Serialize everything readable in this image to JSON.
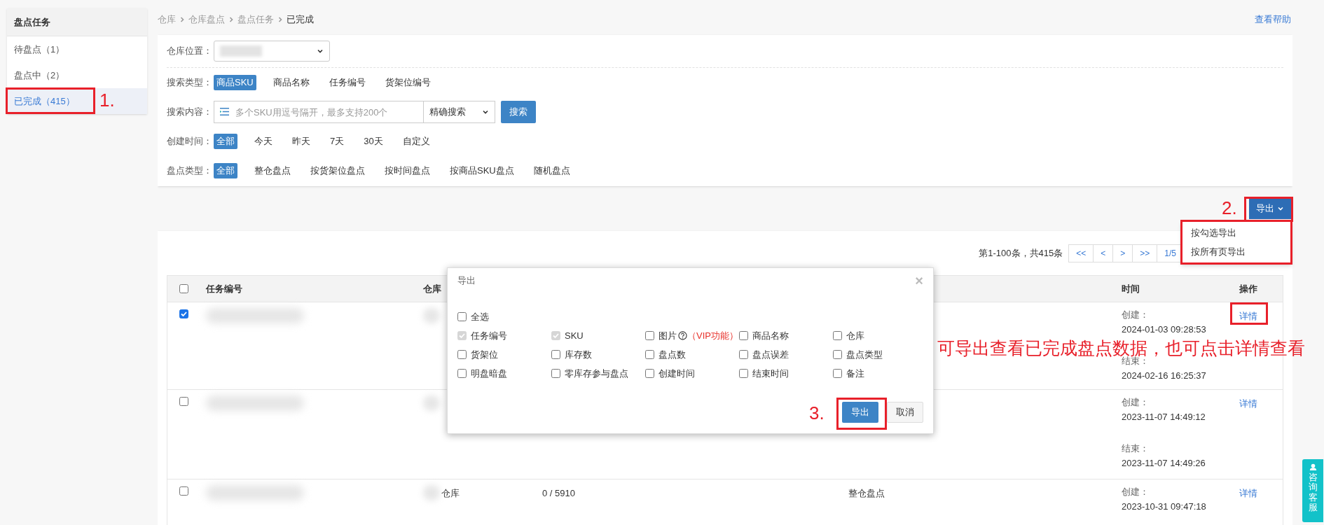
{
  "sidebar": {
    "title": "盘点任务",
    "items": [
      {
        "label": "待盘点（1）",
        "selected": false
      },
      {
        "label": "盘点中（2）",
        "selected": false
      },
      {
        "label": "已完成（415）",
        "selected": true
      }
    ]
  },
  "breadcrumb": [
    "仓库",
    "仓库盘点",
    "盘点任务",
    "已完成"
  ],
  "help_link": "查看帮助",
  "filters": [
    {
      "kind": "select",
      "label": "仓库位置："
    },
    {
      "kind": "options",
      "label": "搜索类型：",
      "options": [
        {
          "label": "商品SKU",
          "selected": true
        },
        {
          "label": "商品名称",
          "selected": false
        },
        {
          "label": "任务编号",
          "selected": false
        },
        {
          "label": "货架位编号",
          "selected": false
        }
      ]
    },
    {
      "kind": "search",
      "label": "搜索内容：",
      "placeholder": "多个SKU用逗号隔开，最多支持200个",
      "mode": "精确搜索",
      "button": "搜索"
    },
    {
      "kind": "options",
      "label": "创建时间：",
      "options": [
        {
          "label": "全部",
          "selected": true
        },
        {
          "label": "今天",
          "selected": false
        },
        {
          "label": "昨天",
          "selected": false
        },
        {
          "label": "7天",
          "selected": false
        },
        {
          "label": "30天",
          "selected": false
        },
        {
          "label": "自定义",
          "selected": false
        }
      ]
    },
    {
      "kind": "options",
      "label": "盘点类型：",
      "options": [
        {
          "label": "全部",
          "selected": true
        },
        {
          "label": "整仓盘点",
          "selected": false
        },
        {
          "label": "按货架位盘点",
          "selected": false
        },
        {
          "label": "按时间盘点",
          "selected": false
        },
        {
          "label": "按商品SKU盘点",
          "selected": false
        },
        {
          "label": "随机盘点",
          "selected": false
        }
      ]
    }
  ],
  "export": {
    "button": "导出",
    "menu": [
      "按勾选导出",
      "按所有页导出"
    ]
  },
  "pagination": {
    "summary": "第1-100条，共415条",
    "buttons": [
      "<<",
      "<",
      ">",
      ">>",
      "1/5"
    ]
  },
  "table": {
    "select_all": false,
    "columns": [
      "任务编号",
      "仓库",
      "时间",
      "操作"
    ],
    "rows": [
      {
        "selected": true,
        "created_label": "创建：",
        "created": "2024-01-03 09:28:53",
        "ended_label": "结束：",
        "ended": "2024-02-16 16:25:37",
        "action": "详情"
      },
      {
        "selected": false,
        "created_label": "创建：",
        "created": "2023-11-07 14:49:12",
        "ended_label": "结束：",
        "ended": "2023-11-07 14:49:26",
        "action": "详情"
      },
      {
        "selected": false,
        "warehouse": "仓库",
        "column_3": "0 / 5910",
        "column_4": "整仓盘点",
        "created_label": "创建：",
        "created": "2023-10-31 09:47:18",
        "action": "详情"
      }
    ]
  },
  "export_dialog": {
    "title": "导出",
    "close": "×",
    "select_all": {
      "label": "全选",
      "checked": false
    },
    "fields": [
      {
        "label": "任务编号",
        "checked": true,
        "disabled": true
      },
      {
        "label": "SKU",
        "checked": true,
        "disabled": true
      },
      {
        "label": "图片",
        "checked": false,
        "disabled": false,
        "help_icon": true,
        "note": "（VIP功能）"
      },
      {
        "label": "商品名称",
        "checked": false,
        "disabled": false
      },
      {
        "label": "仓库",
        "checked": false,
        "disabled": false
      },
      {
        "label": "货架位",
        "checked": false,
        "disabled": false
      },
      {
        "label": "库存数",
        "checked": false,
        "disabled": false
      },
      {
        "label": "盘点数",
        "checked": false,
        "disabled": false
      },
      {
        "label": "盘点误差",
        "checked": false,
        "disabled": false
      },
      {
        "label": "盘点类型",
        "checked": false,
        "disabled": false
      },
      {
        "label": "明盘暗盘",
        "checked": false,
        "disabled": false
      },
      {
        "label": "零库存参与盘点",
        "checked": false,
        "disabled": false
      },
      {
        "label": "创建时间",
        "checked": false,
        "disabled": false
      },
      {
        "label": "结束时间",
        "checked": false,
        "disabled": false
      },
      {
        "label": "备注",
        "checked": false,
        "disabled": false
      }
    ],
    "confirm": "导出",
    "cancel": "取消"
  },
  "annotations": {
    "steps": [
      "1.",
      "2.",
      "3."
    ],
    "note": "可导出查看已完成盘点数据，也可点击详情查看"
  },
  "support_button": "咨询客服"
}
